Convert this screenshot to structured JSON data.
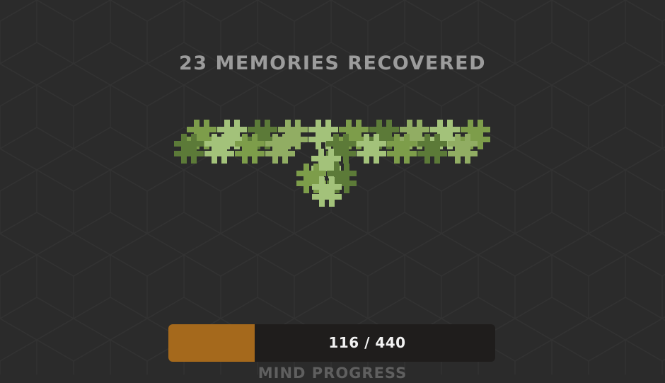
{
  "screen": {
    "title": "23 MEMORIES RECOVERED",
    "memories_recovered": 23
  },
  "memory_cluster": {
    "shape": "hash",
    "palette": [
      "#5c7a38",
      "#7d9d4a",
      "#a3c27a",
      "#91ad63"
    ]
  },
  "progress": {
    "text": "116 / 440",
    "current": 116,
    "total": 440,
    "label": "MIND PROGRESS",
    "fill_color": "#a5691c"
  }
}
